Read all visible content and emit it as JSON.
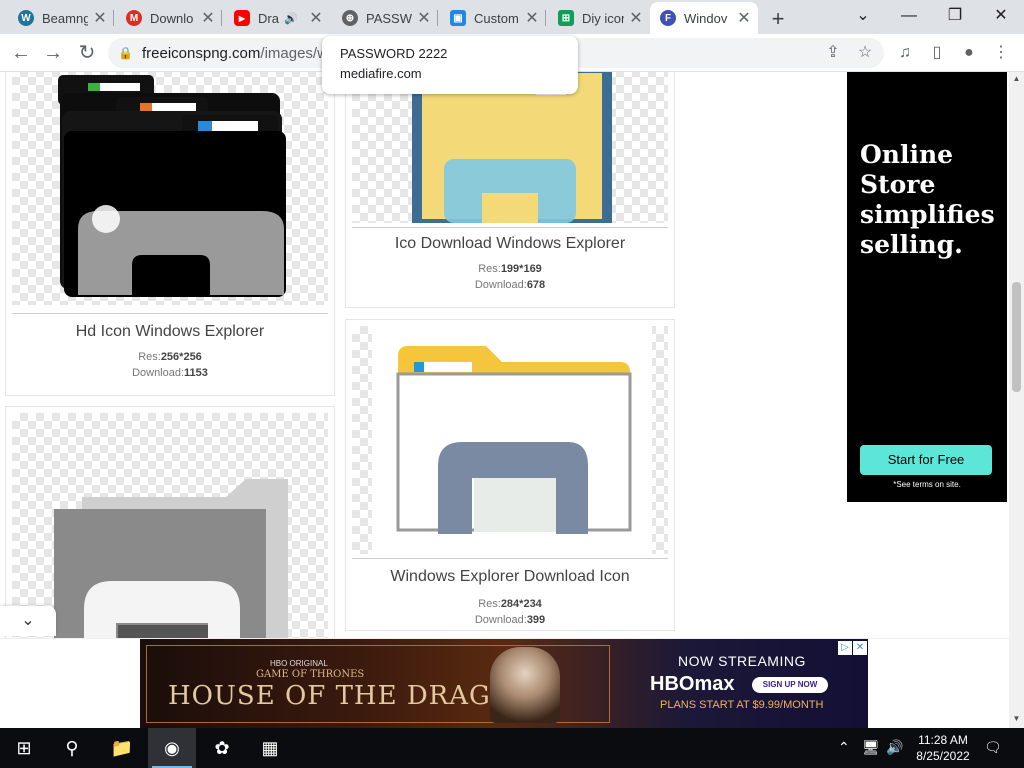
{
  "tabs": [
    {
      "title": "Beamng",
      "favicon_color": "#21759b",
      "favicon_letter": "W"
    },
    {
      "title": "Downlo",
      "favicon_color": "#d93025",
      "favicon_letter": "M"
    },
    {
      "title": "Dra",
      "favicon_color": "#ff0000",
      "favicon_letter": "▶",
      "audio": "🔊"
    },
    {
      "title": "PASSWO",
      "favicon_color": "#5f6368",
      "favicon_letter": "⊕"
    },
    {
      "title": "Custom",
      "favicon_color": "#1e88e5",
      "favicon_letter": "▣"
    },
    {
      "title": "Diy icor",
      "favicon_color": "#0f9d58",
      "favicon_letter": "⊞"
    },
    {
      "title": "Windov",
      "favicon_color": "#3f51b5",
      "favicon_letter": "F"
    }
  ],
  "window_controls": {
    "tab_search": "⌄",
    "minimize": "—",
    "maximize": "❐",
    "close": "✕"
  },
  "toolbar": {
    "back": "←",
    "forward": "→",
    "reload": "↻",
    "url_domain": "freeiconspng.com",
    "url_path": "/images/wi",
    "share": "⇪",
    "star": "☆",
    "media": "♫",
    "sidepanel": "▯",
    "profile": "●",
    "menu": "⋮"
  },
  "tooltip": {
    "title": "PASSWORD 2222",
    "url": "mediafire.com"
  },
  "cards": [
    {
      "caption": "Hd Icon Windows Explorer",
      "res_label": "Res:",
      "res": "256*256",
      "dl_label": "Download:",
      "downloads": "1153"
    },
    {
      "caption": "Ico Download Windows Explorer",
      "res_label": "Res:",
      "res": "199*169",
      "dl_label": "Download:",
      "downloads": "678"
    },
    {
      "caption": "Windows Explorer Download Icon",
      "res_label": "Res:",
      "res": "284*234",
      "dl_label": "Download:",
      "downloads": "399"
    }
  ],
  "side_ad": {
    "headline": "Online Store simplifies selling.",
    "button": "Start for Free",
    "terms": "*See terms on site."
  },
  "banner_ad": {
    "hbo_original": "HBO ORIGINAL",
    "series": "GAME OF THRONES",
    "show": "HOUSE OF THE DRAGON",
    "now_streaming": "NOW STREAMING",
    "brand": "HBOmax",
    "signup": "SIGN UP NOW",
    "plans": "PLANS START AT $9.99/MONTH",
    "ad_choice": "▷",
    "ad_close": "✕"
  },
  "taskbar": {
    "start": "⊞",
    "search": "⚲",
    "explorer": "📁",
    "chrome": "◉",
    "app4": "✿",
    "app5": "▦",
    "tray_up": "⌃",
    "network": "🖥",
    "volume": "🔊",
    "time": "11:28 AM",
    "date": "8/25/2022",
    "notifications": "🗨"
  }
}
